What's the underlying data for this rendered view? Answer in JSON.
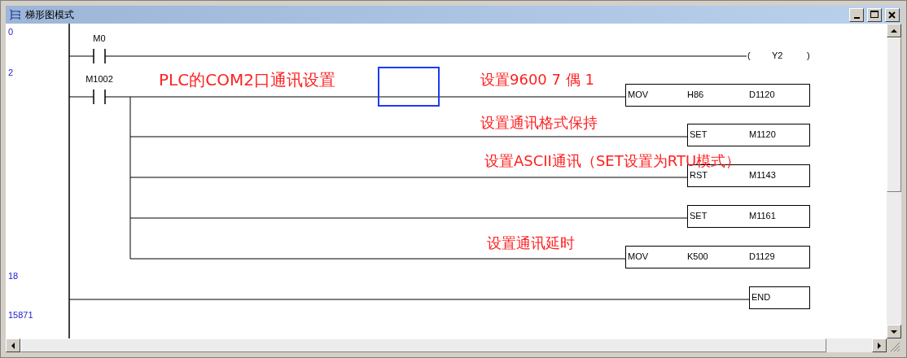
{
  "window": {
    "title": "梯形图模式"
  },
  "step_numbers": [
    "0",
    "2",
    "18",
    "15871"
  ],
  "contacts": [
    "M0",
    "M1002"
  ],
  "coil": {
    "open": "(",
    "operand": "Y2",
    "close": ")"
  },
  "instructions": [
    {
      "mnemonic": "MOV",
      "operands": [
        "H86",
        "D1120"
      ]
    },
    {
      "mnemonic": "SET",
      "operands": [
        "M1120"
      ]
    },
    {
      "mnemonic": "RST",
      "operands": [
        "M1143"
      ]
    },
    {
      "mnemonic": "SET",
      "operands": [
        "M1161"
      ]
    },
    {
      "mnemonic": "MOV",
      "operands": [
        "K500",
        "D1129"
      ]
    },
    {
      "mnemonic": "END"
    }
  ],
  "annotations": [
    {
      "kind": "title",
      "text": "PLC的COM2口通讯设置"
    },
    {
      "kind": "note",
      "text": "设置9600 7 偶 1"
    },
    {
      "kind": "note",
      "text": "设置通讯格式保持"
    },
    {
      "kind": "note",
      "text": "设置ASCII通讯（SET设置为RTU模式）"
    },
    {
      "kind": "note",
      "text": "设置通讯延时"
    }
  ]
}
